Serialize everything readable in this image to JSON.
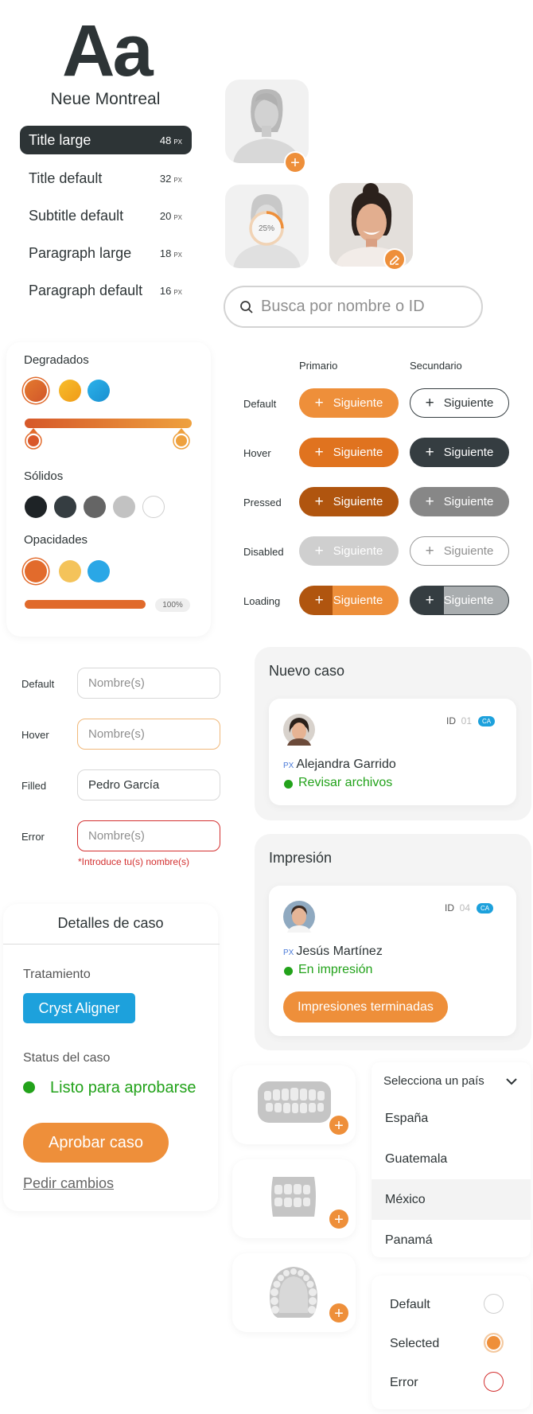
{
  "typography": {
    "sample": "Aa",
    "font_name": "Neue Montreal",
    "unit": "PX",
    "styles": [
      {
        "label": "Title large",
        "size": "48"
      },
      {
        "label": "Title default",
        "size": "32"
      },
      {
        "label": "Subtitle default",
        "size": "20"
      },
      {
        "label": "Paragraph large",
        "size": "18"
      },
      {
        "label": "Paragraph default",
        "size": "16"
      }
    ]
  },
  "avatars": {
    "progress_label": "25%"
  },
  "search": {
    "placeholder": "Busca por nombre o ID"
  },
  "colors": {
    "gradients_label": "Degradados",
    "solids_label": "Sólidos",
    "opacities_label": "Opacidades",
    "opacity_value": "100%",
    "gradient_swatches": [
      "#e06a2b",
      "#f4ac22",
      "#1d9fdc"
    ],
    "solid_swatches": [
      "#1e2326",
      "#353d41",
      "#656565",
      "#c2c2c2",
      "#ffffff"
    ],
    "opacity_swatches": [
      "#e26b2c",
      "#f4c35a",
      "#2aa7e6"
    ]
  },
  "buttons": {
    "col_primary": "Primario",
    "col_secondary": "Secundario",
    "label": "Siguiente",
    "states": [
      "Default",
      "Hover",
      "Pressed",
      "Disabled",
      "Loading"
    ]
  },
  "form": {
    "states": [
      "Default",
      "Hover",
      "Filled",
      "Error"
    ],
    "placeholder": "Nombre(s)",
    "filled_value": "Pedro García",
    "error_message": "*Introduce tu(s) nombre(s)"
  },
  "case_details": {
    "title": "Detalles de caso",
    "treatment_label": "Tratamiento",
    "treatment_value": "Cryst Aligner",
    "status_label": "Status del caso",
    "status_value": "Listo para aprobarse",
    "approve_button": "Aprobar caso",
    "changes_link": "Pedir cambios"
  },
  "new_case": {
    "title": "Nuevo caso",
    "id_label": "ID",
    "id_value": "01",
    "badge": "CA",
    "px": "PX",
    "patient": "Alejandra Garrido",
    "status": "Revisar archivos"
  },
  "impression": {
    "title": "Impresión",
    "id_label": "ID",
    "id_value": "04",
    "badge": "CA",
    "px": "PX",
    "patient": "Jesús Martínez",
    "status": "En impresión",
    "button": "Impresiones terminadas"
  },
  "country": {
    "placeholder": "Selecciona un país",
    "options": [
      "España",
      "Guatemala",
      "México",
      "Panamá"
    ]
  },
  "radios": {
    "states": [
      "Default",
      "Selected",
      "Error"
    ]
  },
  "accent": {
    "orange": "#ee8f3a",
    "dark": "#353d41",
    "blue": "#1da1dc",
    "green": "#22a21a",
    "error": "#d32f2f"
  }
}
